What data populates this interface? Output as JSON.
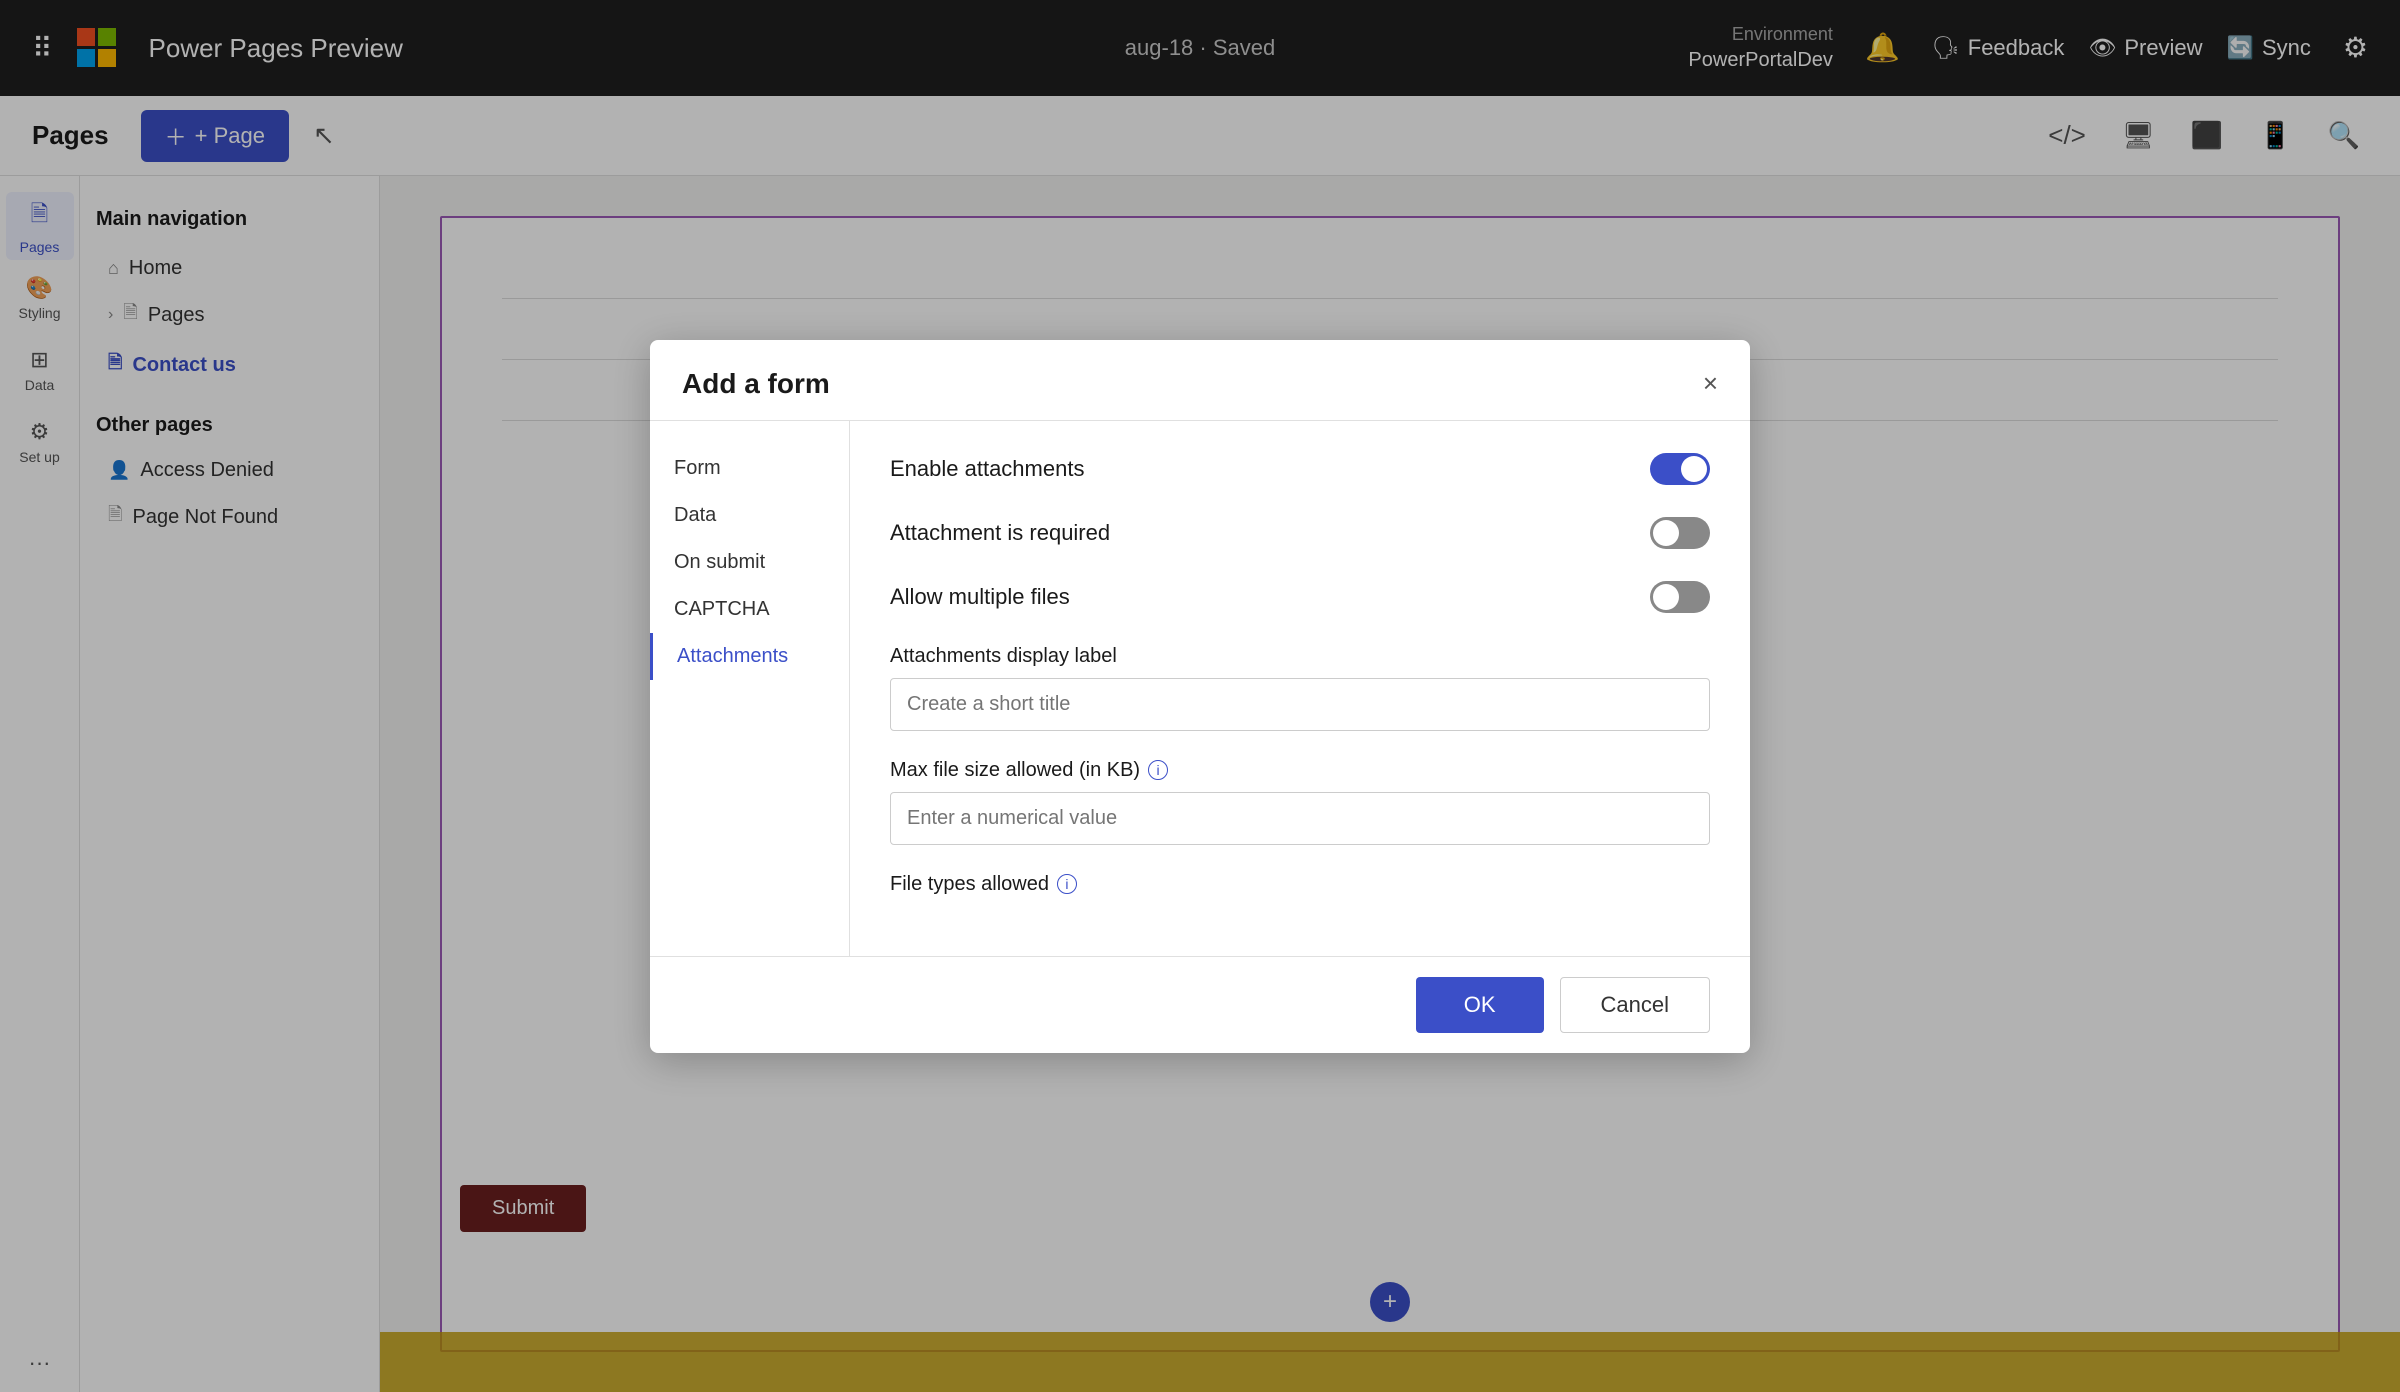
{
  "topNav": {
    "appTitle": "Power Pages Preview",
    "savedStatus": "aug-18 · Saved",
    "environment": {
      "label": "Environment",
      "name": "PowerPortalDev"
    },
    "actions": {
      "feedback": "Feedback",
      "preview": "Preview",
      "sync": "Sync"
    }
  },
  "sidebar": {
    "items": [
      {
        "id": "pages",
        "label": "Pages",
        "icon": "🗎"
      },
      {
        "id": "styling",
        "label": "Styling",
        "icon": "🎨"
      },
      {
        "id": "data",
        "label": "Data",
        "icon": "⊞"
      },
      {
        "id": "setup",
        "label": "Set up",
        "icon": "⚙"
      }
    ]
  },
  "pagesPanel": {
    "title": "Pages",
    "addPageBtn": "+ Page",
    "mainNavLabel": "Main navigation",
    "mainNavItems": [
      {
        "id": "home",
        "label": "Home",
        "icon": "⌂"
      },
      {
        "id": "pages",
        "label": "Pages",
        "icon": "🗎",
        "hasExpand": true
      },
      {
        "id": "contact-us",
        "label": "Contact us",
        "icon": "🗎",
        "active": true
      }
    ],
    "otherPagesLabel": "Other pages",
    "otherPages": [
      {
        "id": "access-denied",
        "label": "Access Denied",
        "icon": "👤"
      },
      {
        "id": "page-not-found",
        "label": "Page Not Found",
        "icon": "🗎"
      }
    ]
  },
  "canvas": {
    "submitBtnLabel": "Submit",
    "addBtnLabel": "+"
  },
  "dialog": {
    "title": "Add a form",
    "closeLabel": "×",
    "navItems": [
      {
        "id": "form",
        "label": "Form"
      },
      {
        "id": "data",
        "label": "Data"
      },
      {
        "id": "on-submit",
        "label": "On submit"
      },
      {
        "id": "captcha",
        "label": "CAPTCHA"
      },
      {
        "id": "attachments",
        "label": "Attachments",
        "active": true
      }
    ],
    "content": {
      "enableAttachments": {
        "label": "Enable attachments",
        "value": true
      },
      "attachmentRequired": {
        "label": "Attachment is required",
        "value": false
      },
      "allowMultiple": {
        "label": "Allow multiple files",
        "value": false
      },
      "displayLabel": {
        "label": "Attachments display label",
        "placeholder": "Create a short title"
      },
      "maxFileSize": {
        "label": "Max file size allowed (in KB)",
        "placeholder": "Enter a numerical value",
        "hasInfo": true
      },
      "fileTypes": {
        "label": "File types allowed",
        "hasInfo": true
      }
    },
    "footer": {
      "okLabel": "OK",
      "cancelLabel": "Cancel"
    }
  }
}
